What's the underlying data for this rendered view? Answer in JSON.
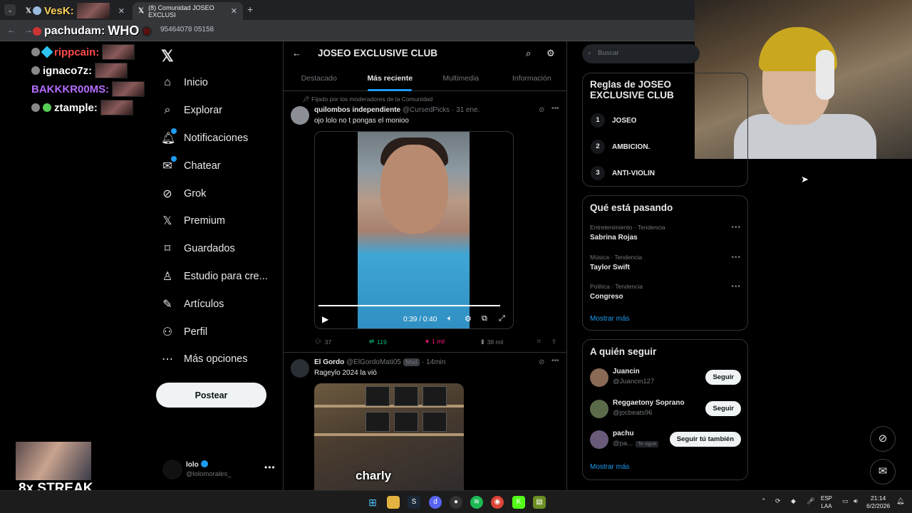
{
  "browser": {
    "tab1_title": "",
    "tab2_title": "(8) Comunidad JOSEO EXCLUSI",
    "url": "95464078 05158"
  },
  "stream": {
    "chat_top": [
      {
        "user": "pachudam:",
        "text": "WHO"
      },
      {
        "user": "VesK:",
        "text": ""
      }
    ],
    "chat": [
      {
        "user": "rippcain:",
        "color": "#ff4b4b"
      },
      {
        "user": "ignaco7z:",
        "color": "#ffffff"
      },
      {
        "user": "BAKKKR00MS:",
        "color": "#b56cff"
      },
      {
        "user": "ztample:",
        "color": "#ffffff"
      }
    ],
    "streak": "8x STREAK"
  },
  "sidebar": {
    "items": [
      {
        "label": "Inicio",
        "icon": "home-icon",
        "glyph": "⌂"
      },
      {
        "label": "Explorar",
        "icon": "search-icon",
        "glyph": "⌕"
      },
      {
        "label": "Notificaciones",
        "icon": "bell-icon",
        "glyph": "🔔︎"
      },
      {
        "label": "Chatear",
        "icon": "mail-icon",
        "glyph": "✉"
      },
      {
        "label": "Grok",
        "icon": "grok-icon",
        "glyph": "⊘"
      },
      {
        "label": "Premium",
        "icon": "x-icon",
        "glyph": "𝕏"
      },
      {
        "label": "Guardados",
        "icon": "bookmark-icon",
        "glyph": "⌑"
      },
      {
        "label": "Estudio para cre...",
        "icon": "studio-icon",
        "glyph": "♙"
      },
      {
        "label": "Artículos",
        "icon": "articles-icon",
        "glyph": "✎"
      },
      {
        "label": "Perfil",
        "icon": "profile-icon",
        "glyph": "⚇"
      },
      {
        "label": "Más opciones",
        "icon": "more-icon",
        "glyph": "⋯"
      }
    ],
    "post_button": "Postear",
    "account": {
      "name": "lolo",
      "handle": "@lolomorales_"
    }
  },
  "community": {
    "title": "JOSEO EXCLUSIVE CLUB",
    "tabs": [
      "Destacado",
      "Más reciente",
      "Multimedia",
      "Información"
    ],
    "active_tab": "Más reciente"
  },
  "posts": [
    {
      "pinned_label": "Fijado por los moderadores de la Comunidad",
      "author": "quilombos independiente",
      "handle": "@CursedPicks",
      "time": "· 31 ene.",
      "text": "ojo lolo no t pongas el monioo",
      "video_time": "0:39 / 0:40",
      "video_progress": 0.975,
      "replies": "37",
      "reposts": "119",
      "likes": "1 mil",
      "views": "38 mil"
    },
    {
      "author": "El Gordo",
      "handle": "@ElGordoMati05",
      "badge": "Mod",
      "time": "· 14min",
      "text": "Rageylo 2024 la vió",
      "caption": "charly"
    }
  ],
  "right": {
    "search_placeholder": "Buscar",
    "rules_title": "Reglas de JOSEO EXCLUSIVE CLUB",
    "rules": [
      {
        "num": "1",
        "text": "JOSEO"
      },
      {
        "num": "2",
        "text": "AMBICION."
      },
      {
        "num": "3",
        "text": "ANTI-VIOLIN"
      }
    ],
    "trends_title": "Qué está pasando",
    "trends": [
      {
        "category": "Entretenimiento · Tendencia",
        "title": "Sabrina Rojas"
      },
      {
        "category": "Música · Tendencia",
        "title": "Taylor Swift"
      },
      {
        "category": "Política · Tendencia",
        "title": "Congreso"
      }
    ],
    "show_more": "Mostrar más",
    "who_title": "A quién seguir",
    "follows": [
      {
        "name": "Juancin",
        "handle": "@Juancin127",
        "button": "Seguir",
        "tag": ""
      },
      {
        "name": "Reggaetony Soprano",
        "handle": "@jocbeats96",
        "button": "Seguir",
        "tag": ""
      },
      {
        "name": "pachu",
        "handle": "@pa...",
        "button": "Seguir tú también",
        "tag": "Te sigue"
      }
    ]
  },
  "taskbar": {
    "lang": "ESP",
    "lang2": "LAA",
    "time": "21:14",
    "date": "6/2/2026"
  }
}
